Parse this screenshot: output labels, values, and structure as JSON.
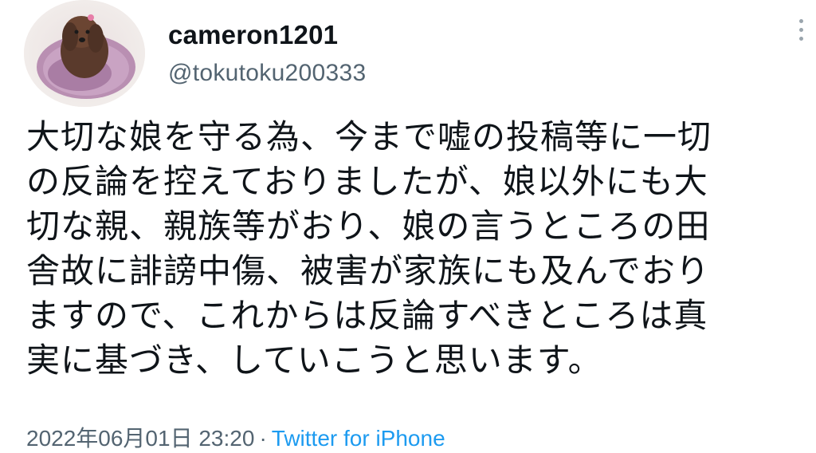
{
  "user": {
    "display_name": "cameron1201",
    "handle": "@tokutoku200333",
    "avatar": "avatar-photo-dog"
  },
  "menu": {
    "icon": "more-options-vertical-icon"
  },
  "tweet": {
    "lines": [
      "大切な娘を守る為、今まで嘘の投稿等に一切",
      "の反論を控えておりましたが、娘以外にも大",
      "切な親、親族等がおり、娘の言うところの田",
      "舎故に誹謗中傷、被害が家族にも及んでおり",
      "ますので、これからは反論すべきところは真",
      "実に基づき、していこうと思います。"
    ]
  },
  "meta": {
    "timestamp": "2022年06月01日 23:20",
    "separator": "·",
    "source": "Twitter for iPhone"
  },
  "colors": {
    "text": "#0f1419",
    "secondary": "#536471",
    "link": "#1d9bf0"
  }
}
